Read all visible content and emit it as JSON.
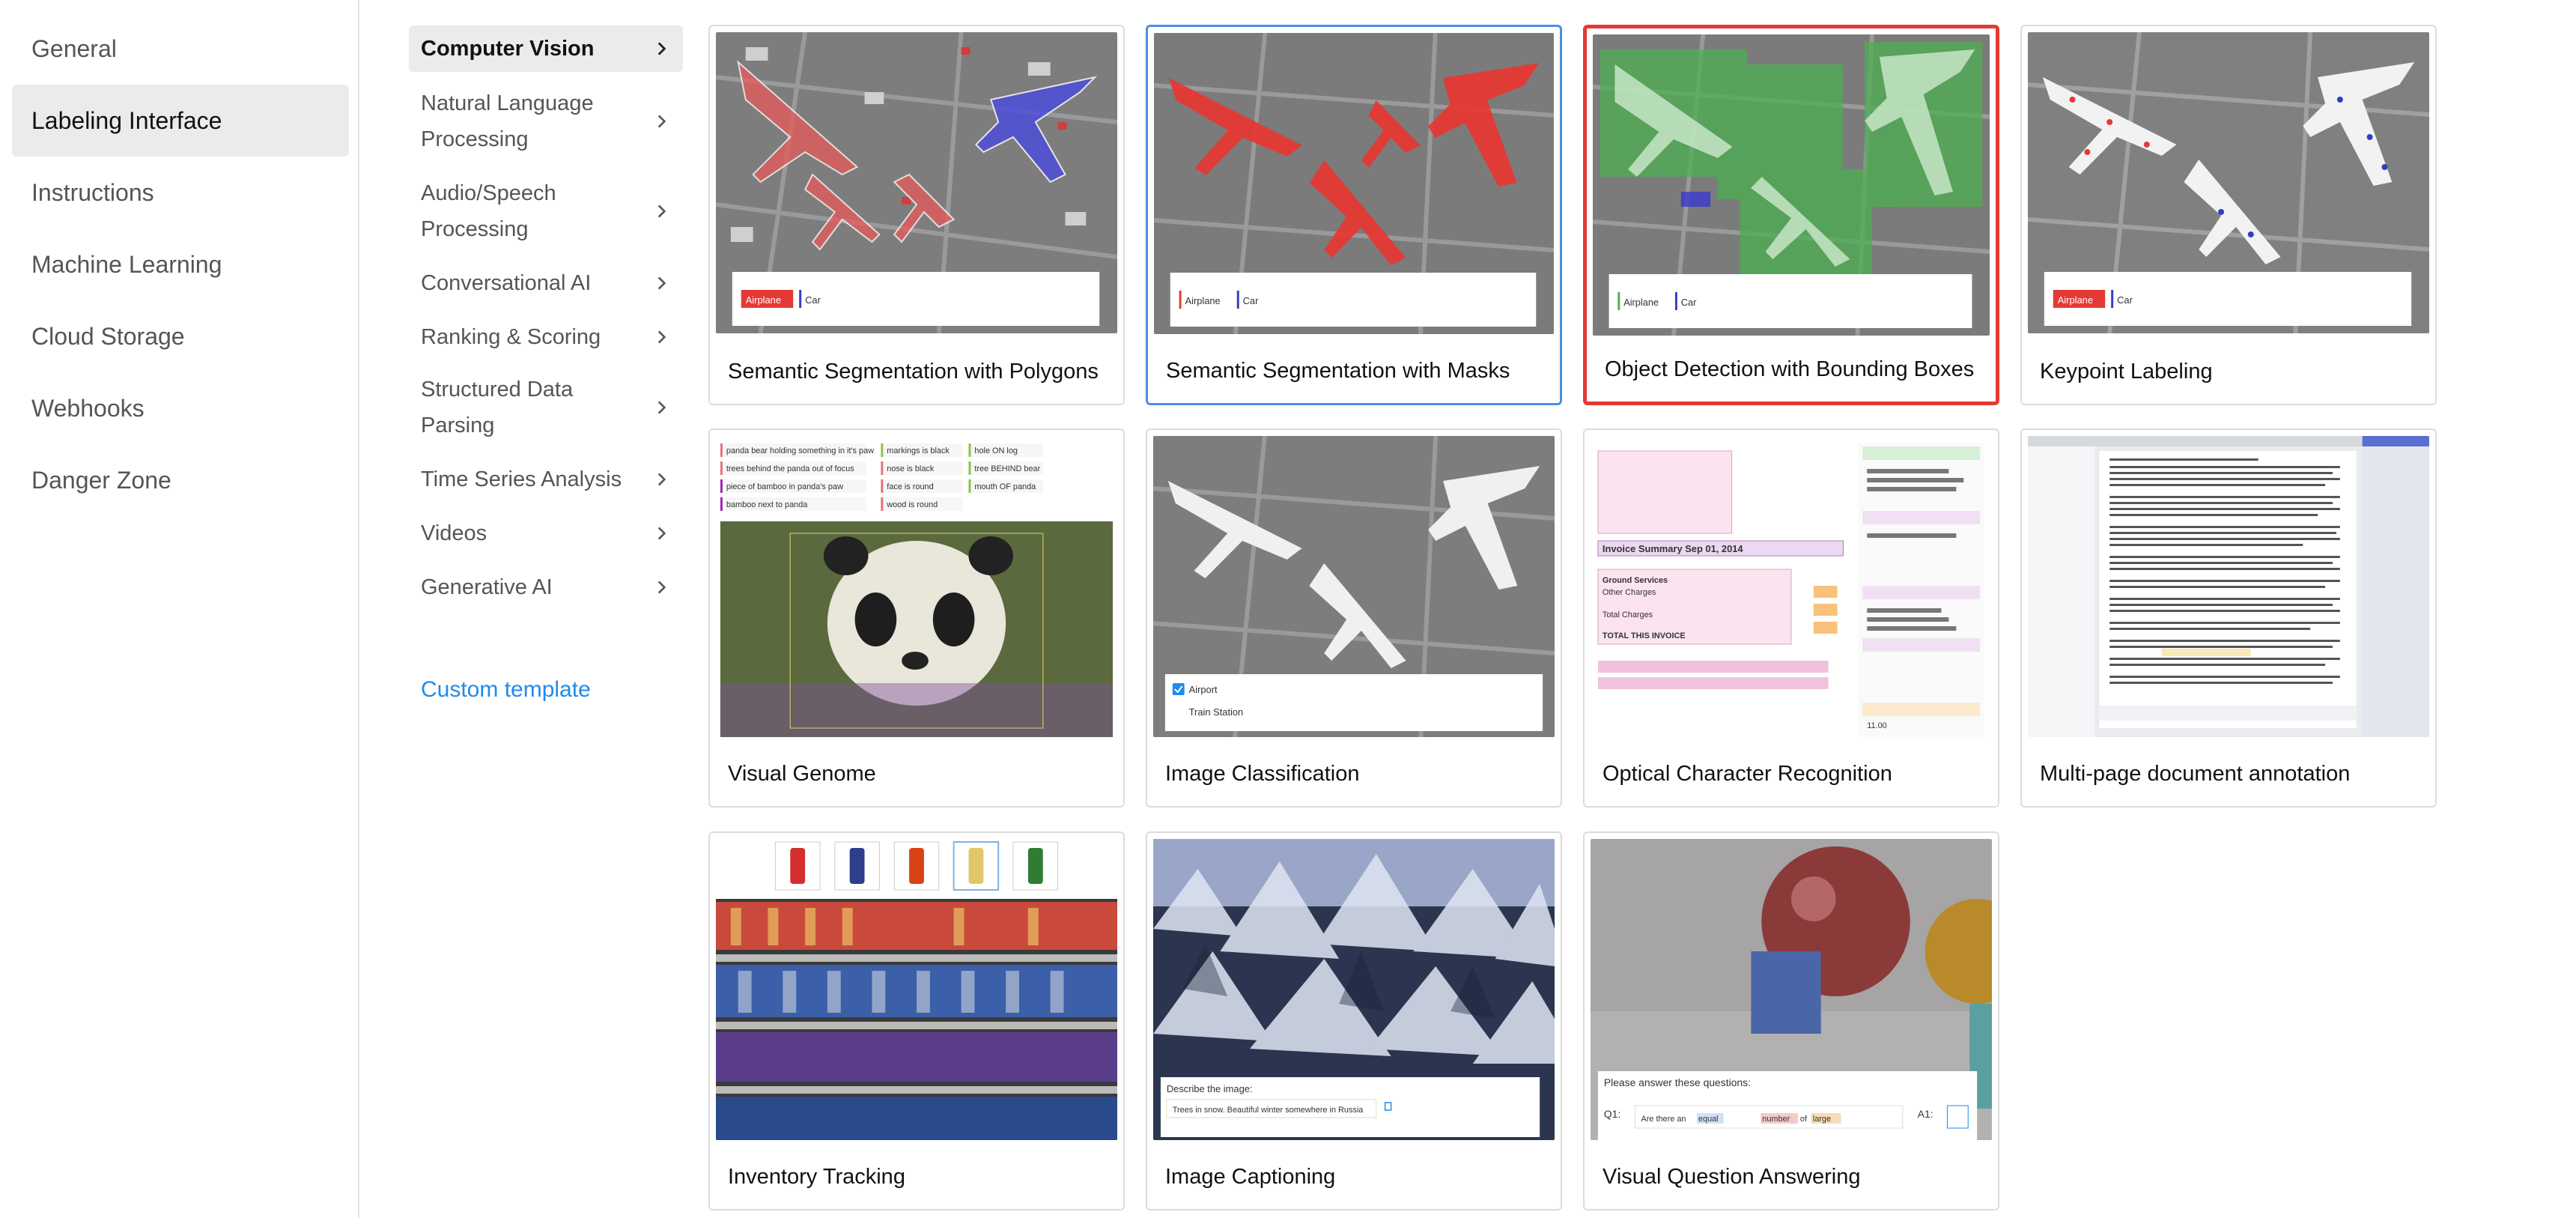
{
  "settings_nav": {
    "items": [
      {
        "label": "General",
        "active": false
      },
      {
        "label": "Labeling Interface",
        "active": true
      },
      {
        "label": "Instructions",
        "active": false
      },
      {
        "label": "Machine Learning",
        "active": false
      },
      {
        "label": "Cloud Storage",
        "active": false
      },
      {
        "label": "Webhooks",
        "active": false
      },
      {
        "label": "Danger Zone",
        "active": false
      }
    ]
  },
  "categories": {
    "items": [
      {
        "label": "Computer Vision",
        "active": true,
        "icon": "chevron-right-icon"
      },
      {
        "label": "Natural Language Processing",
        "active": false,
        "icon": "chevron-right-icon"
      },
      {
        "label": "Audio/Speech Processing",
        "active": false,
        "icon": "chevron-right-icon"
      },
      {
        "label": "Conversational AI",
        "active": false,
        "icon": "chevron-right-icon"
      },
      {
        "label": "Ranking & Scoring",
        "active": false,
        "icon": "chevron-right-icon"
      },
      {
        "label": "Structured Data Parsing",
        "active": false,
        "icon": "chevron-right-icon"
      },
      {
        "label": "Time Series Analysis",
        "active": false,
        "icon": "chevron-right-icon"
      },
      {
        "label": "Videos",
        "active": false,
        "icon": "chevron-right-icon"
      },
      {
        "label": "Generative AI",
        "active": false,
        "icon": "chevron-right-icon"
      }
    ],
    "custom_template_link": "Custom template"
  },
  "templates": [
    {
      "title": "Semantic Segmentation with Polygons",
      "state": "default"
    },
    {
      "title": "Semantic Segmentation with Masks",
      "state": "hovered"
    },
    {
      "title": "Object Detection with Bounding Boxes",
      "state": "selected"
    },
    {
      "title": "Keypoint Labeling",
      "state": "default"
    },
    {
      "title": "Visual Genome",
      "state": "default"
    },
    {
      "title": "Image Classification",
      "state": "default"
    },
    {
      "title": "Optical Character Recognition",
      "state": "default"
    },
    {
      "title": "Multi-page document annotation",
      "state": "default"
    },
    {
      "title": "Inventory Tracking",
      "state": "default"
    },
    {
      "title": "Image Captioning",
      "state": "default"
    },
    {
      "title": "Visual Question Answering",
      "state": "default"
    }
  ],
  "thumbnails": {
    "label_airplane": "Airplane",
    "label_car": "Car",
    "label_airport": "Airport",
    "label_train_station": "Train Station",
    "caption_prompt": "Describe the image:",
    "caption_text": "Trees in snow. Beautiful winter somewhere in Russia",
    "vqa_prompt": "Please answer these questions:",
    "vqa_q1": "Q1:",
    "vqa_a1": "A1:",
    "vqa_question_a": "Are there an",
    "vqa_question_b": "equal",
    "vqa_question_c": "number",
    "vqa_question_d": "of",
    "vqa_question_e": "large",
    "ocr_invoice": "Invoice Summary Sep 01, 2014",
    "ocr_ground": "Ground Services",
    "ocr_other": "Other Charges",
    "ocr_total": "Total Charges",
    "ocr_total_invoice": "TOTAL THIS INVOICE",
    "ocr_value": "11.00",
    "vg_rows": [
      "panda bear holding something in it's paw",
      "trees behind the panda out of focus",
      "piece of bamboo in panda's paw",
      "bamboo next to panda"
    ],
    "vg_attrs": [
      "markings is black",
      "nose is black",
      "face is round",
      "wood is round"
    ],
    "vg_rels": [
      "hole ON log",
      "tree BEHIND bear",
      "mouth OF panda"
    ]
  },
  "colors": {
    "accent_blue": "#1f8bea",
    "selected_border": "#e53935",
    "hover_border": "#4a90e2",
    "active_bg": "#ebebeb"
  }
}
